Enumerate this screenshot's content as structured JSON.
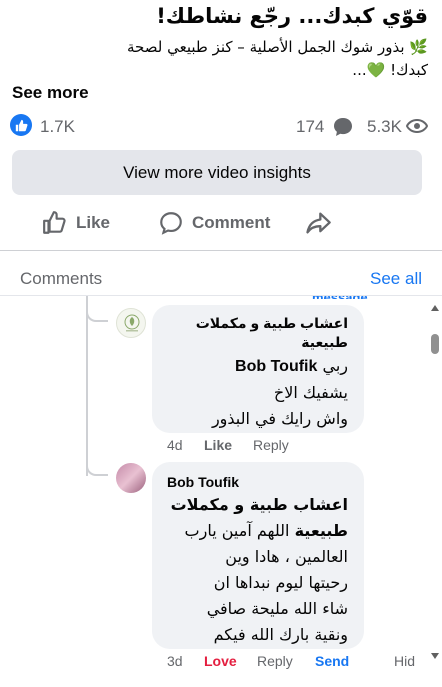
{
  "post": {
    "title": "قوّي كبدك... رجّع نشاطك!",
    "description": "🌿 بذور شوك الجمل الأصلية – كنز طبيعي لصحة كبدك! 💚...",
    "desc_line1": "بذور شوك الجمل الأصلية – كنز طبيعي لصحة",
    "desc_line2": "كبدك!",
    "see_more": "See more"
  },
  "stats": {
    "reactions": "1.7K",
    "comments": "174",
    "views": "5.3K"
  },
  "insights_button": "View more video insights",
  "actions": {
    "like": "Like",
    "comment": "Comment"
  },
  "comments_section": {
    "label": "Comments",
    "see_all": "See all",
    "cut_text": "message"
  },
  "comments": [
    {
      "author": "اعشاب طبية و مكملات طبيعية",
      "author_line1": "اعشاب طبية و مكملات",
      "author_line2": "طبيعية",
      "mention": "Bob Toufik",
      "mention_prefix": "ربي",
      "text_line1": "يشفيك الاخ",
      "text_line2": "واش رايك في البذور",
      "time": "4d",
      "like_label": "Like",
      "reply_label": "Reply"
    },
    {
      "author": "Bob Toufik",
      "mention_line1": "اعشاب طبية و مكملات",
      "mention_line2": "طبيعية",
      "text_after_mention": "اللهم آمين يارب",
      "text_line3": "العالمين ، هادا وين",
      "text_line4": "رحيتها ليوم نبداها ان",
      "text_line5": "شاء الله مليحة صافي",
      "text_line6": "ونقية بارك الله فيكم",
      "time": "3d",
      "love_label": "Love",
      "reply_label": "Reply",
      "send_label": "Send",
      "hide_label": "Hid"
    }
  ],
  "colors": {
    "brand_blue": "#1877f2",
    "love_red": "#e41e3f",
    "muted": "#65676b",
    "bubble": "#f0f2f5"
  }
}
